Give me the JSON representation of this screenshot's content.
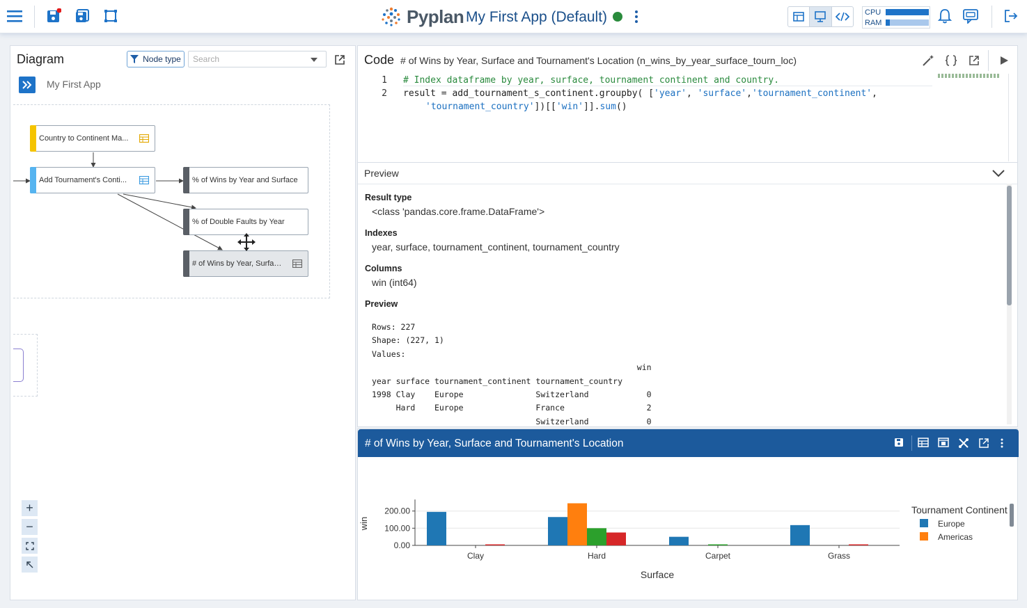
{
  "header": {
    "logo_text": "Pyplan",
    "app_title": "My First App (Default)",
    "cpu_label": "CPU",
    "ram_label": "RAM",
    "cpu_usage": 1.0,
    "ram_usage": 0.1,
    "status_color": "#2a8b3c",
    "icons": [
      "menu-icon",
      "save-icon",
      "save-as-icon",
      "fullscreen-icon",
      "table-view-icon",
      "presentation-view-icon",
      "code-view-icon",
      "bell-icon",
      "chat-icon",
      "logout-icon"
    ]
  },
  "diagram": {
    "title": "Diagram",
    "node_type_label": "Node type",
    "search_placeholder": "Search",
    "breadcrumb": "My First App",
    "nodes": [
      {
        "label": "Country to Continent Ma...",
        "color": "#f5c400"
      },
      {
        "label": "Add Tournament's Conti...",
        "color": "#56b4f0"
      },
      {
        "label": "% of Wins by Year and Surface",
        "color": "#5a5f66"
      },
      {
        "label": "% of Double Faults by Year",
        "color": "#5a5f66"
      },
      {
        "label": "# of Wins by Year, Surfac...",
        "color": "#5a5f66"
      }
    ],
    "zoom_controls": [
      "+",
      "−"
    ]
  },
  "code": {
    "heading": "Code",
    "node_title": "# of Wins by Year, Surface and Tournament's Location (n_wins_by_year_surface_tourn_loc)",
    "line_numbers": [
      "1",
      "2"
    ],
    "line1": "# Index dataframe by year, surface, tournament continent and country.",
    "line2_a": "result = add_tournament_s_continent.groupby( [",
    "line2_s1": "'year'",
    "line2_c1": ", ",
    "line2_s2": "'surface'",
    "line2_c2": ",",
    "line2_s3": "'tournament_continent'",
    "line2_c3": ",",
    "line3_s1": "'tournament_country'",
    "line3_a": "])[[",
    "line3_s2": "'win'",
    "line3_b": "]].",
    "line3_fn": "sum",
    "line3_c": "()"
  },
  "preview": {
    "title": "Preview",
    "result_type_label": "Result type",
    "result_type": "<class 'pandas.core.frame.DataFrame'>",
    "indexes_label": "Indexes",
    "indexes": "year, surface, tournament_continent, tournament_country",
    "columns_label": "Columns",
    "columns": "win (int64)",
    "preview_label": "Preview",
    "text": "Rows: 227\nShape: (227, 1)\nValues:\n                                                       win\nyear surface tournament_continent tournament_country       \n1998 Clay    Europe               Switzerland            0\n     Hard    Europe               France                 2\n                                  Switzerland            0"
  },
  "chart_panel": {
    "title": "# of Wins by Year, Surface and Tournament's Location"
  },
  "chart_data": {
    "type": "bar",
    "categories": [
      "Clay",
      "Hard",
      "Carpet",
      "Grass"
    ],
    "series": [
      {
        "name": "Europe",
        "color": "#1f77b4",
        "values": [
          195,
          165,
          50,
          118
        ]
      },
      {
        "name": "Americas",
        "color": "#ff7f0e",
        "values": [
          0,
          245,
          0,
          0
        ]
      },
      {
        "name": "",
        "color": "#2ca02c",
        "values": [
          0,
          100,
          5,
          0
        ]
      },
      {
        "name": "",
        "color": "#d62728",
        "values": [
          2,
          75,
          0,
          3
        ]
      }
    ],
    "xlabel": "Surface",
    "ylabel": "win",
    "yticks": [
      "0.00",
      "100.00",
      "200.00"
    ],
    "ytick_values": [
      0,
      100,
      200
    ],
    "ylim": [
      0,
      255
    ],
    "legend_title": "Tournament Continent",
    "legend_position": "right",
    "grid": true
  }
}
